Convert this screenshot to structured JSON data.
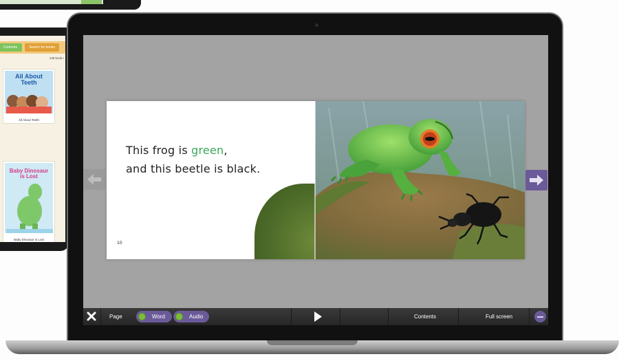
{
  "background_app": {
    "tabs": [
      {
        "label": "Contents",
        "color": "#7cc35c"
      },
      {
        "label": "Search for books",
        "color": "#e0a035"
      }
    ],
    "book_count": "136 book r",
    "books": [
      {
        "title": "All About Teeth",
        "caption": "All About Teeth",
        "title_color": "#1d5aa8"
      },
      {
        "title": "Baby Dinosaur is Lost",
        "caption": "Baby Dinosaur is Lost",
        "title_color": "#d9388a"
      }
    ]
  },
  "reader": {
    "story": {
      "line1_before": "This frog is ",
      "line1_highlight": "green",
      "line1_after": ",",
      "line2": "and this beetle is black."
    },
    "page_number": "10",
    "highlight_color": "#3aa65b"
  },
  "toolbar": {
    "page_label": "Page",
    "word_label": "Word",
    "audio_label": "Audio",
    "contents_label": "Contents",
    "fullscreen_label": "Full screen"
  },
  "colors": {
    "accent": "#6b5a99",
    "toggle_on": "#7dbb3a",
    "screen_bg": "#a3a3a3"
  },
  "icons": {
    "close": "close-icon",
    "prev": "arrow-left-icon",
    "next": "arrow-right-icon",
    "play": "play-icon",
    "menu": "menu-icon"
  }
}
